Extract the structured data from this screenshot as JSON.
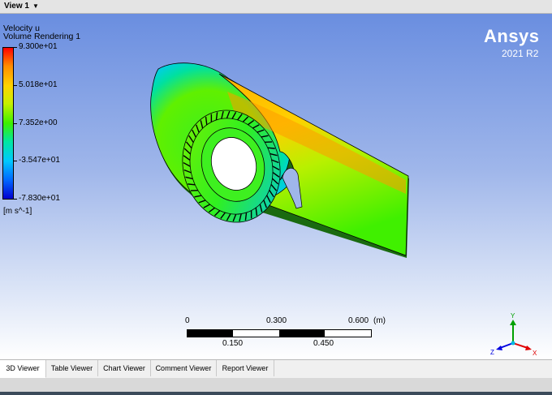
{
  "header": {
    "view_label": "View 1",
    "dropdown_icon": "caret-down-icon"
  },
  "legend": {
    "title_line1": "Velocity u",
    "title_line2": "Volume Rendering 1",
    "ticks": [
      "9.300e+01",
      "5.018e+01",
      "7.352e+00",
      "-3.547e+01",
      "-7.830e+01"
    ],
    "units": "[m s^-1]",
    "colors": [
      "#ff0000",
      "#ffd200",
      "#3cf000",
      "#00c8ff",
      "#0000d0"
    ]
  },
  "brand": {
    "name": "Ansys",
    "version": "2021 R2"
  },
  "scale": {
    "top_labels": [
      "0",
      "0.300",
      "0.600"
    ],
    "bottom_labels": [
      "0.150",
      "0.450"
    ],
    "unit": "(m)"
  },
  "triad": {
    "y": "Y",
    "z": "Z",
    "x": "X"
  },
  "tabs": [
    "3D Viewer",
    "Table Viewer",
    "Chart Viewer",
    "Comment Viewer",
    "Report Viewer"
  ]
}
